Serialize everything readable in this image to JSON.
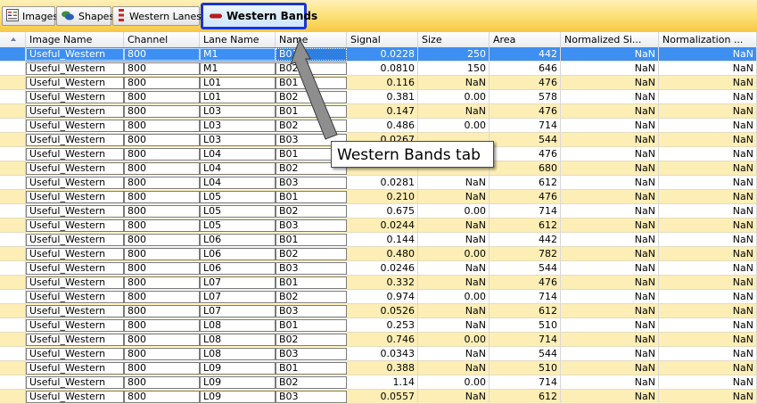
{
  "tabs": [
    {
      "label": "Images",
      "icon": "images-icon"
    },
    {
      "label": "Shapes",
      "icon": "shapes-icon"
    },
    {
      "label": "Western Lanes",
      "icon": "western-lanes-icon"
    },
    {
      "label": "Western Bands",
      "icon": "western-bands-icon",
      "active": true
    }
  ],
  "columns": [
    "Image Name",
    "Channel",
    "Lane Name",
    "Name",
    "Signal",
    "Size",
    "Area",
    "Normalized Si...",
    "Normalization ..."
  ],
  "rows": [
    [
      "Useful_Western",
      "800",
      "M1",
      "B01",
      "0.0228",
      "250",
      "442",
      "NaN",
      "NaN"
    ],
    [
      "Useful_Western",
      "800",
      "M1",
      "B02",
      "0.0810",
      "150",
      "646",
      "NaN",
      "NaN"
    ],
    [
      "Useful_Western",
      "800",
      "L01",
      "B01",
      "0.116",
      "NaN",
      "476",
      "NaN",
      "NaN"
    ],
    [
      "Useful_Western",
      "800",
      "L01",
      "B02",
      "0.381",
      "0.00",
      "578",
      "NaN",
      "NaN"
    ],
    [
      "Useful_Western",
      "800",
      "L03",
      "B01",
      "0.147",
      "NaN",
      "476",
      "NaN",
      "NaN"
    ],
    [
      "Useful_Western",
      "800",
      "L03",
      "B02",
      "0.486",
      "0.00",
      "714",
      "NaN",
      "NaN"
    ],
    [
      "Useful_Western",
      "800",
      "L03",
      "B03",
      "0.0267",
      "",
      "544",
      "NaN",
      "NaN"
    ],
    [
      "Useful_Western",
      "800",
      "L04",
      "B01",
      "",
      "",
      "476",
      "NaN",
      "NaN"
    ],
    [
      "Useful_Western",
      "800",
      "L04",
      "B02",
      "",
      "",
      "680",
      "NaN",
      "NaN"
    ],
    [
      "Useful_Western",
      "800",
      "L04",
      "B03",
      "0.0281",
      "NaN",
      "612",
      "NaN",
      "NaN"
    ],
    [
      "Useful_Western",
      "800",
      "L05",
      "B01",
      "0.210",
      "NaN",
      "476",
      "NaN",
      "NaN"
    ],
    [
      "Useful_Western",
      "800",
      "L05",
      "B02",
      "0.675",
      "0.00",
      "714",
      "NaN",
      "NaN"
    ],
    [
      "Useful_Western",
      "800",
      "L05",
      "B03",
      "0.0244",
      "NaN",
      "612",
      "NaN",
      "NaN"
    ],
    [
      "Useful_Western",
      "800",
      "L06",
      "B01",
      "0.144",
      "NaN",
      "442",
      "NaN",
      "NaN"
    ],
    [
      "Useful_Western",
      "800",
      "L06",
      "B02",
      "0.480",
      "0.00",
      "782",
      "NaN",
      "NaN"
    ],
    [
      "Useful_Western",
      "800",
      "L06",
      "B03",
      "0.0246",
      "NaN",
      "544",
      "NaN",
      "NaN"
    ],
    [
      "Useful_Western",
      "800",
      "L07",
      "B01",
      "0.332",
      "NaN",
      "476",
      "NaN",
      "NaN"
    ],
    [
      "Useful_Western",
      "800",
      "L07",
      "B02",
      "0.974",
      "0.00",
      "714",
      "NaN",
      "NaN"
    ],
    [
      "Useful_Western",
      "800",
      "L07",
      "B03",
      "0.0526",
      "NaN",
      "612",
      "NaN",
      "NaN"
    ],
    [
      "Useful_Western",
      "800",
      "L08",
      "B01",
      "0.253",
      "NaN",
      "510",
      "NaN",
      "NaN"
    ],
    [
      "Useful_Western",
      "800",
      "L08",
      "B02",
      "0.746",
      "0.00",
      "714",
      "NaN",
      "NaN"
    ],
    [
      "Useful_Western",
      "800",
      "L08",
      "B03",
      "0.0343",
      "NaN",
      "544",
      "NaN",
      "NaN"
    ],
    [
      "Useful_Western",
      "800",
      "L09",
      "B01",
      "0.388",
      "NaN",
      "510",
      "NaN",
      "NaN"
    ],
    [
      "Useful_Western",
      "800",
      "L09",
      "B02",
      "1.14",
      "0.00",
      "714",
      "NaN",
      "NaN"
    ],
    [
      "Useful_Western",
      "800",
      "L09",
      "B03",
      "0.0557",
      "NaN",
      "612",
      "NaN",
      "NaN"
    ]
  ],
  "selected_row": 0,
  "callout": {
    "text": "Western Bands tab"
  },
  "colors": {
    "tabbar": "#fde27c",
    "active_tab_border": "#1a35d4",
    "row_alt": "#fdeeb5",
    "selection": "#3d8ff2",
    "arrow": "#8e8e8e"
  }
}
